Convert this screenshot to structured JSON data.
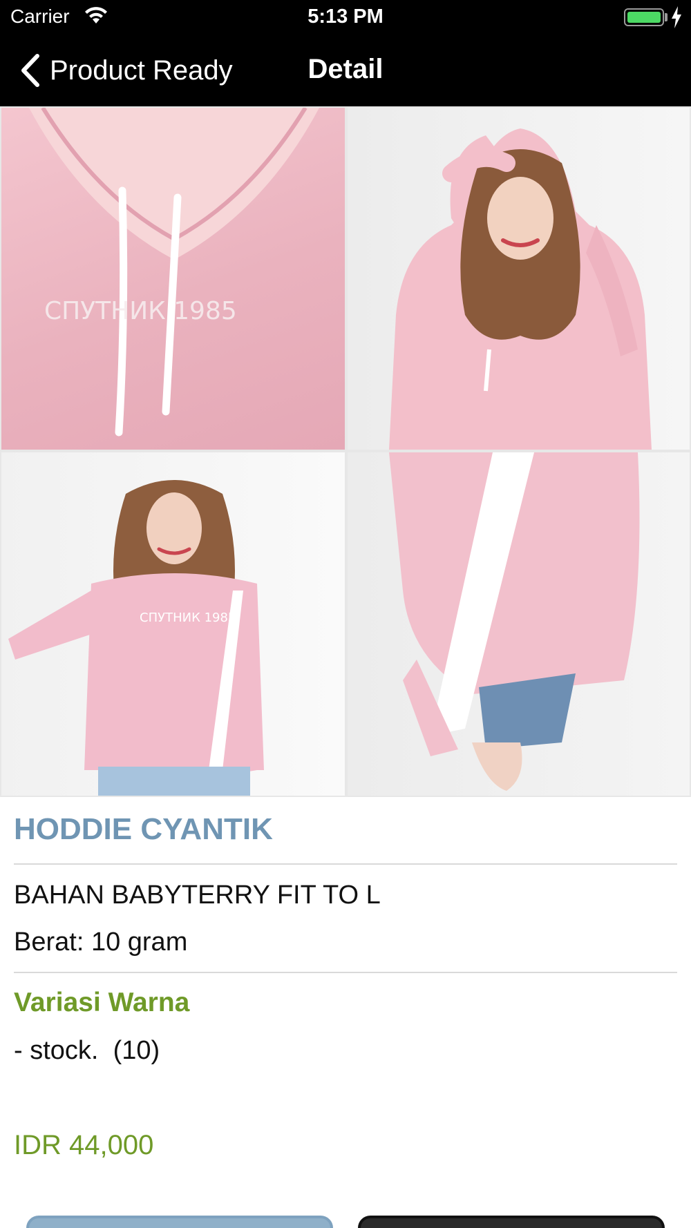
{
  "status_bar": {
    "carrier": "Carrier",
    "time": "5:13 PM",
    "battery_level": 1.0,
    "charging": true
  },
  "nav": {
    "back_label": "Product Ready",
    "title": "Detail"
  },
  "colors": {
    "title": "#6f95b3",
    "accent_green": "#6f9a28",
    "nav_background": "#000000"
  },
  "product": {
    "name": "HODDIE CYANTIK",
    "description": "BAHAN BABYTERRY FIT TO L",
    "weight": "Berat: 10 gram",
    "variation_heading": "Variasi Warna",
    "stock_line": "- stock.  (10)",
    "price": "IDR 44,000",
    "images": [
      {
        "name": "product-photo-1",
        "print_text": "СПУТНИК 1985"
      },
      {
        "name": "product-photo-2"
      },
      {
        "name": "product-photo-3"
      },
      {
        "name": "product-photo-4"
      }
    ]
  }
}
